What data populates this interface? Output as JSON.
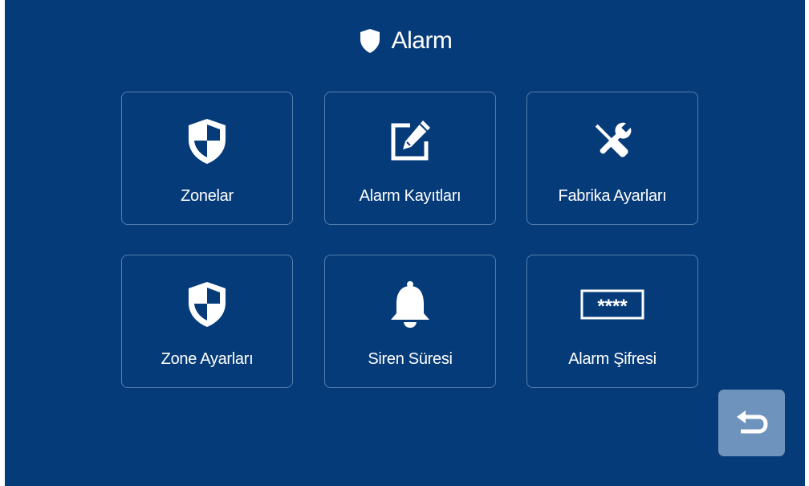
{
  "header": {
    "title": "Alarm",
    "icon": "shield-icon"
  },
  "tiles": [
    {
      "label": "Zonelar",
      "icon": "security-shield-icon"
    },
    {
      "label": "Alarm Kayıtları",
      "icon": "edit-note-icon"
    },
    {
      "label": "Fabrika Ayarları",
      "icon": "tools-icon"
    },
    {
      "label": "Zone Ayarları",
      "icon": "security-shield-icon"
    },
    {
      "label": "Siren Süresi",
      "icon": "bell-icon"
    },
    {
      "label": "Alarm Şifresi",
      "icon": "password-field-icon",
      "icon_text": "****"
    }
  ],
  "back_button": {
    "icon": "back-arrow-icon"
  },
  "colors": {
    "background": "#063b7a",
    "tile_border": "#7fa3cf",
    "back_button": "#6e93bd",
    "text": "#ffffff"
  }
}
